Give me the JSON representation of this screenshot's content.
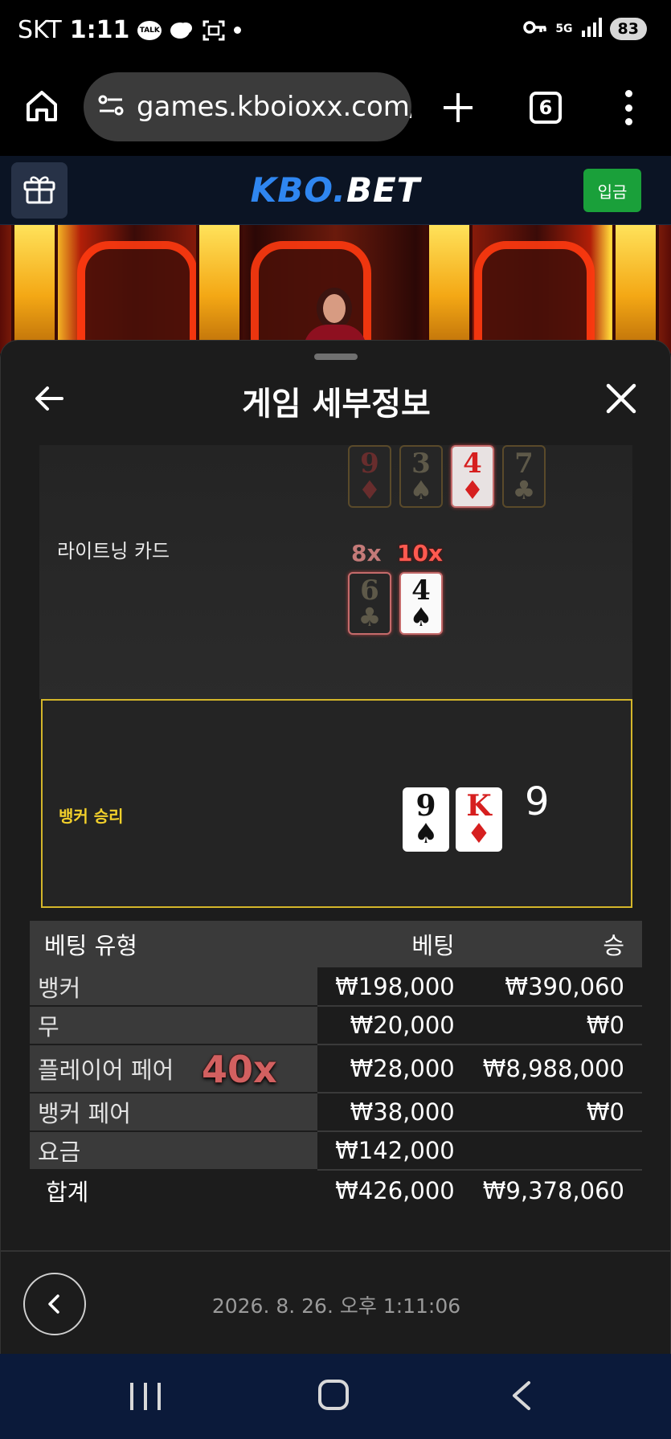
{
  "status_bar": {
    "carrier": "SKT",
    "time": "1:11",
    "talk_badge": "TALK",
    "network": "5G",
    "battery": "83"
  },
  "browser": {
    "url": "games.kboioxx.com/",
    "tab_count": "6"
  },
  "site": {
    "logo_part1": "KBO.",
    "logo_part2": "BET",
    "deposit_label": "입금"
  },
  "modal": {
    "title": "게임 세부정보",
    "lightning_label": "라이트닝 카드",
    "lightning_top_cards": [
      {
        "rank": "9",
        "suit": "♦",
        "color": "red",
        "active": false
      },
      {
        "rank": "3",
        "suit": "♠",
        "color": "black",
        "active": false
      },
      {
        "rank": "4",
        "suit": "♦",
        "color": "red",
        "active": true
      },
      {
        "rank": "7",
        "suit": "♣",
        "color": "black",
        "active": false
      }
    ],
    "lightning_bottom_cards": [
      {
        "rank": "6",
        "suit": "♣",
        "color": "black",
        "active": false,
        "multiplier": "8x"
      },
      {
        "rank": "4",
        "suit": "♠",
        "color": "black",
        "active": true,
        "multiplier": "10x"
      }
    ],
    "result_label": "뱅커 승리",
    "result_cards": [
      {
        "rank": "9",
        "suit": "♠",
        "color": "black"
      },
      {
        "rank": "K",
        "suit": "♦",
        "color": "red"
      }
    ],
    "result_score": "9",
    "table": {
      "headers": [
        "베팅 유형",
        "베팅",
        "승"
      ],
      "rows": [
        {
          "type": "뱅커",
          "bet": "₩198,000",
          "win": "₩390,060"
        },
        {
          "type": "무",
          "bet": "₩20,000",
          "win": "₩0"
        },
        {
          "type": "플레이어 페어",
          "bet": "₩28,000",
          "win": "₩8,988,000",
          "badge": "40x"
        },
        {
          "type": "뱅커 페어",
          "bet": "₩38,000",
          "win": "₩0"
        },
        {
          "type": "요금",
          "bet": "₩142,000",
          "win": ""
        }
      ],
      "total": {
        "type": "합계",
        "bet": "₩426,000",
        "win": "₩9,378,060"
      }
    },
    "timestamp": "2026. 8. 26. 오후 1:11:06"
  }
}
